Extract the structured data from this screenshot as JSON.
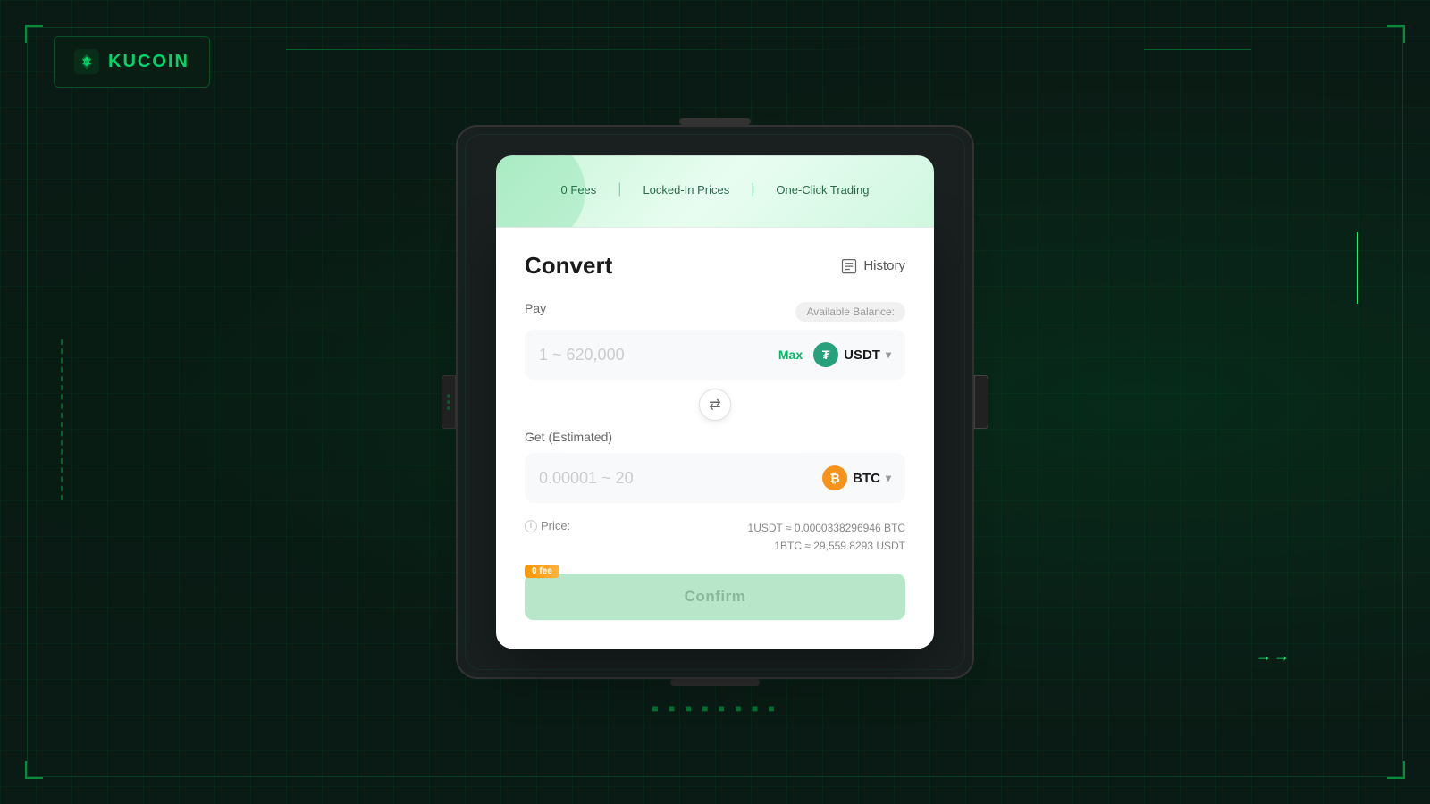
{
  "app": {
    "name": "KuCoin",
    "logo_text": "KUCOIN"
  },
  "banner": {
    "items": [
      "0 Fees",
      "Locked-In Prices",
      "One-Click Trading"
    ],
    "divider": "|"
  },
  "convert": {
    "title": "Convert",
    "history_label": "History",
    "pay_label": "Pay",
    "available_balance_label": "Available Balance:",
    "pay_placeholder": "1 ~ 620,000",
    "max_label": "Max",
    "pay_currency": "USDT",
    "get_label": "Get (Estimated)",
    "get_placeholder": "0.00001 ~ 20",
    "get_currency": "BTC",
    "price_label": "Price:",
    "price_line1": "1USDT ≈ 0.0000338296946 BTC",
    "price_line2": "1BTC ≈ 29,559.8293 USDT",
    "zero_fee_badge": "0 fee",
    "confirm_label": "Confirm",
    "swap_icon": "⇄"
  }
}
